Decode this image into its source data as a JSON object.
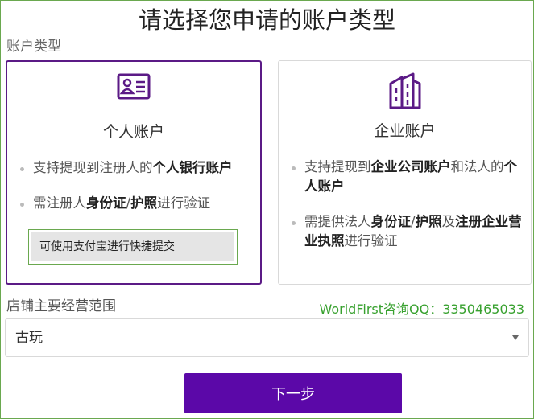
{
  "page": {
    "title": "请选择您申请的账户类型"
  },
  "account_type": {
    "label": "账户类型",
    "cards": [
      {
        "title": "个人账户",
        "icon": "id-card-icon",
        "selected": true,
        "bullets": [
          {
            "parts": [
              {
                "text": "支持提现到注册人的",
                "bold": false
              },
              {
                "text": "个人银行账户",
                "bold": true
              }
            ]
          },
          {
            "parts": [
              {
                "text": "需注册人",
                "bold": false
              },
              {
                "text": "身份证",
                "bold": true
              },
              {
                "text": "/",
                "bold": false
              },
              {
                "text": "护照",
                "bold": true
              },
              {
                "text": "进行验证",
                "bold": false
              }
            ]
          }
        ],
        "alipay_hint": "可使用支付宝进行快捷提交"
      },
      {
        "title": "企业账户",
        "icon": "building-icon",
        "selected": false,
        "bullets": [
          {
            "parts": [
              {
                "text": "支持提现到",
                "bold": false
              },
              {
                "text": "企业公司账户",
                "bold": true
              },
              {
                "text": "和法人的",
                "bold": false
              },
              {
                "text": "个人账户",
                "bold": true
              }
            ]
          },
          {
            "parts": [
              {
                "text": "需提供法人",
                "bold": false
              },
              {
                "text": "身份证",
                "bold": true
              },
              {
                "text": "/",
                "bold": false
              },
              {
                "text": "护照",
                "bold": true
              },
              {
                "text": "及",
                "bold": false
              },
              {
                "text": "注册企业营业执照",
                "bold": true
              },
              {
                "text": "进行验证",
                "bold": false
              }
            ]
          }
        ]
      }
    ]
  },
  "scope": {
    "label": "店铺主要经营范围",
    "value": "古玩"
  },
  "contact": "WorldFirst咨询QQ：3350465033",
  "next_button": "下一步",
  "colors": {
    "accent": "#5b08a8",
    "selected_border": "#5b1a86",
    "contact": "#38a12f",
    "frame": "#6aa84f"
  }
}
